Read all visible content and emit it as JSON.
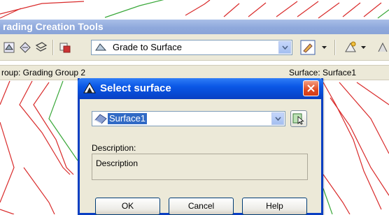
{
  "palette": {
    "title": "rading Creation Tools",
    "grade_mode": "Grade to Surface",
    "status_group": "roup: Grading Group 2",
    "status_surface": "Surface: Surface1"
  },
  "dialog": {
    "title": "Select surface",
    "surface_value": "Surface1",
    "description_label": "Description:",
    "description_value": "Description",
    "ok_label": "OK",
    "cancel_label": "Cancel",
    "help_label": "Help"
  },
  "colors": {
    "contour_red": "#d92b2b",
    "contour_green": "#3aa83a",
    "title_blue": "#0a57e6",
    "selection": "#316ac5"
  },
  "icons": [
    "app-icon",
    "close-icon",
    "surface-icon",
    "pick-surface-icon",
    "chevron-down-icon"
  ]
}
